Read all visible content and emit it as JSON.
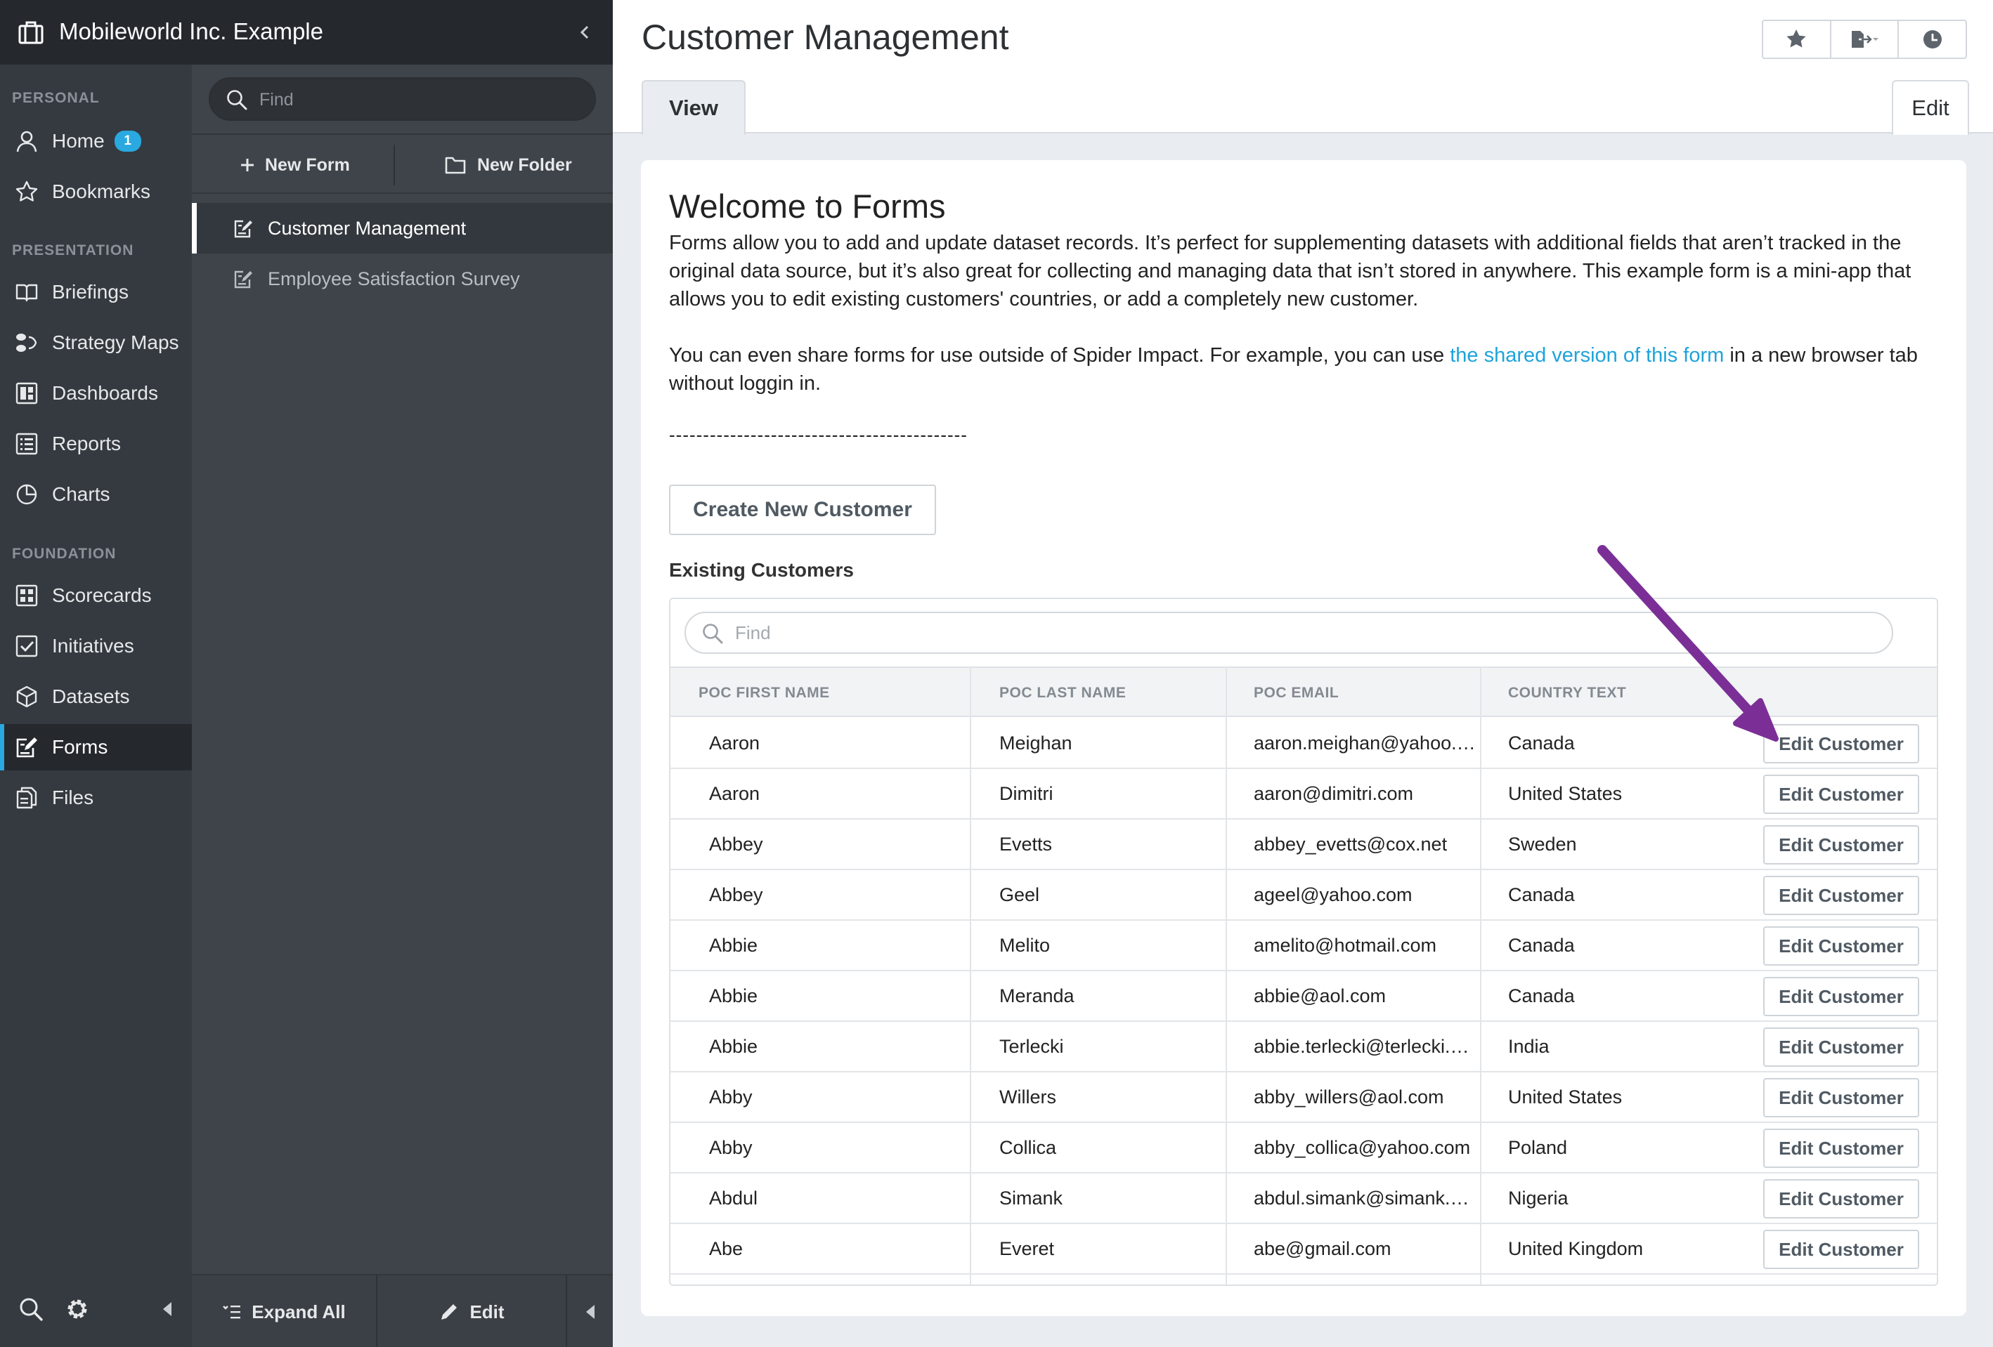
{
  "app": {
    "org_name": "Mobileworld Inc. Example"
  },
  "nav": {
    "sections": {
      "personal": "PERSONAL",
      "presentation": "PRESENTATION",
      "foundation": "FOUNDATION"
    },
    "items": {
      "home": "Home",
      "home_badge": "1",
      "bookmarks": "Bookmarks",
      "briefings": "Briefings",
      "strategy_maps": "Strategy Maps",
      "dashboards": "Dashboards",
      "reports": "Reports",
      "charts": "Charts",
      "scorecards": "Scorecards",
      "initiatives": "Initiatives",
      "datasets": "Datasets",
      "forms": "Forms",
      "files": "Files"
    },
    "active_item": "Forms"
  },
  "panel": {
    "search_placeholder": "Find",
    "new_form": "New Form",
    "new_folder": "New Folder",
    "tree": [
      "Customer Management",
      "Employee Satisfaction Survey"
    ],
    "selected": "Customer Management",
    "footer": {
      "expand_all": "Expand All",
      "edit": "Edit"
    }
  },
  "main": {
    "title": "Customer Management",
    "tabs": {
      "view": "View",
      "edit": "Edit"
    },
    "active_tab": "View",
    "welcome_title": "Welcome to Forms",
    "paragraph1": "Forms allow you to add and update dataset records. It’s perfect for supplementing datasets with additional fields that aren’t tracked in the original data source, but it’s also great for collecting and managing data that isn’t stored in anywhere. This example form is a mini-app that allows you to edit existing customers' countries, or add a completely new customer.",
    "paragraph2_before": "You can even share forms for use outside of Spider Impact. For example, you can use ",
    "paragraph2_link": "the shared version of this form",
    "paragraph2_after": " in a new browser tab without loggin in.",
    "divider_text": "--------------------------------------------",
    "create_button": "Create New Customer",
    "existing_label": "Existing Customers",
    "table_search_placeholder": "Find",
    "row_button_label": "Edit Customer",
    "columns": [
      "POC FIRST NAME",
      "POC LAST NAME",
      "POC EMAIL",
      "COUNTRY TEXT"
    ],
    "rows": [
      [
        "Aaron",
        "Meighan",
        "aaron.meighan@yahoo.com",
        "Canada"
      ],
      [
        "Aaron",
        "Dimitri",
        "aaron@dimitri.com",
        "United States"
      ],
      [
        "Abbey",
        "Evetts",
        "abbey_evetts@cox.net",
        "Sweden"
      ],
      [
        "Abbey",
        "Geel",
        "ageel@yahoo.com",
        "Canada"
      ],
      [
        "Abbie",
        "Melito",
        "amelito@hotmail.com",
        "Canada"
      ],
      [
        "Abbie",
        "Meranda",
        "abbie@aol.com",
        "Canada"
      ],
      [
        "Abbie",
        "Terlecki",
        "abbie.terlecki@terlecki.com",
        "India"
      ],
      [
        "Abby",
        "Willers",
        "abby_willers@aol.com",
        "United States"
      ],
      [
        "Abby",
        "Collica",
        "abby_collica@yahoo.com",
        "Poland"
      ],
      [
        "Abdul",
        "Simank",
        "abdul.simank@simank.com",
        "Nigeria"
      ],
      [
        "Abe",
        "Everet",
        "abe@gmail.com",
        "United Kingdom"
      ]
    ]
  },
  "colors": {
    "accent": "#2aa8e0",
    "nav_bg": "#353a40",
    "panel_bg": "#3f444a",
    "annotation_arrow": "#7b2f96"
  }
}
